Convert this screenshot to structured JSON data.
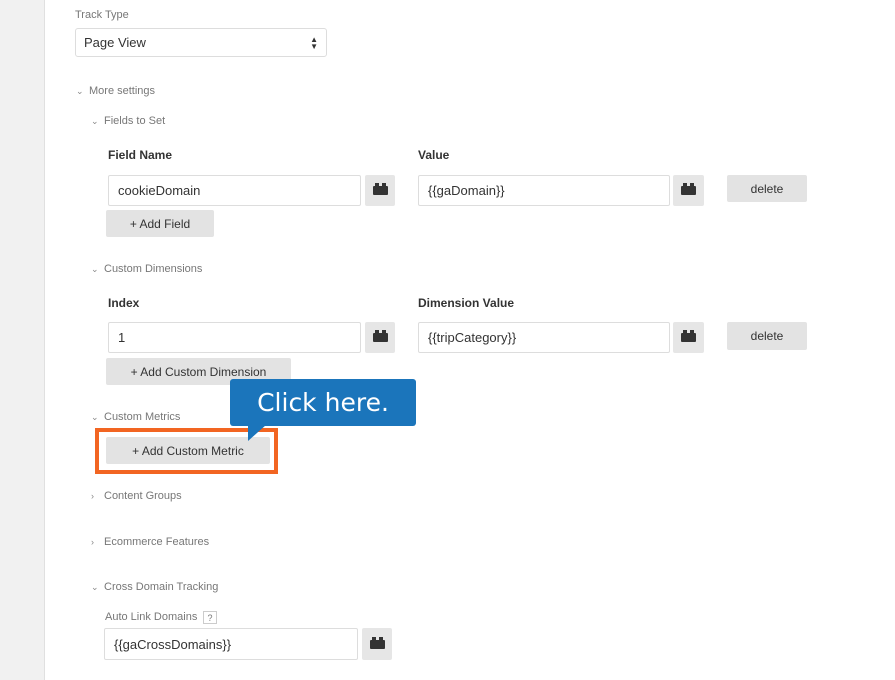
{
  "track_type": {
    "label": "Track Type",
    "value": "Page View"
  },
  "more_settings": "More settings",
  "fields_to_set": {
    "title": "Fields to Set",
    "col_name": "Field Name",
    "col_value": "Value",
    "rows": [
      {
        "name": "cookieDomain",
        "value": "{{gaDomain}}",
        "delete": "delete"
      }
    ],
    "add": "+ Add Field"
  },
  "custom_dimensions": {
    "title": "Custom Dimensions",
    "col_index": "Index",
    "col_value": "Dimension Value",
    "rows": [
      {
        "index": "1",
        "value": "{{tripCategory}}",
        "delete": "delete"
      }
    ],
    "add": "+ Add Custom Dimension"
  },
  "custom_metrics": {
    "title": "Custom Metrics",
    "add": "+ Add Custom Metric"
  },
  "callout": "Click here.",
  "content_groups": "Content Groups",
  "ecommerce": "Ecommerce Features",
  "cross_domain": {
    "title": "Cross Domain Tracking",
    "auto_link_label": "Auto Link Domains",
    "help": "?",
    "value": "{{gaCrossDomains}}"
  },
  "colors": {
    "callout": "#1b75bb",
    "highlight": "#f26522"
  }
}
